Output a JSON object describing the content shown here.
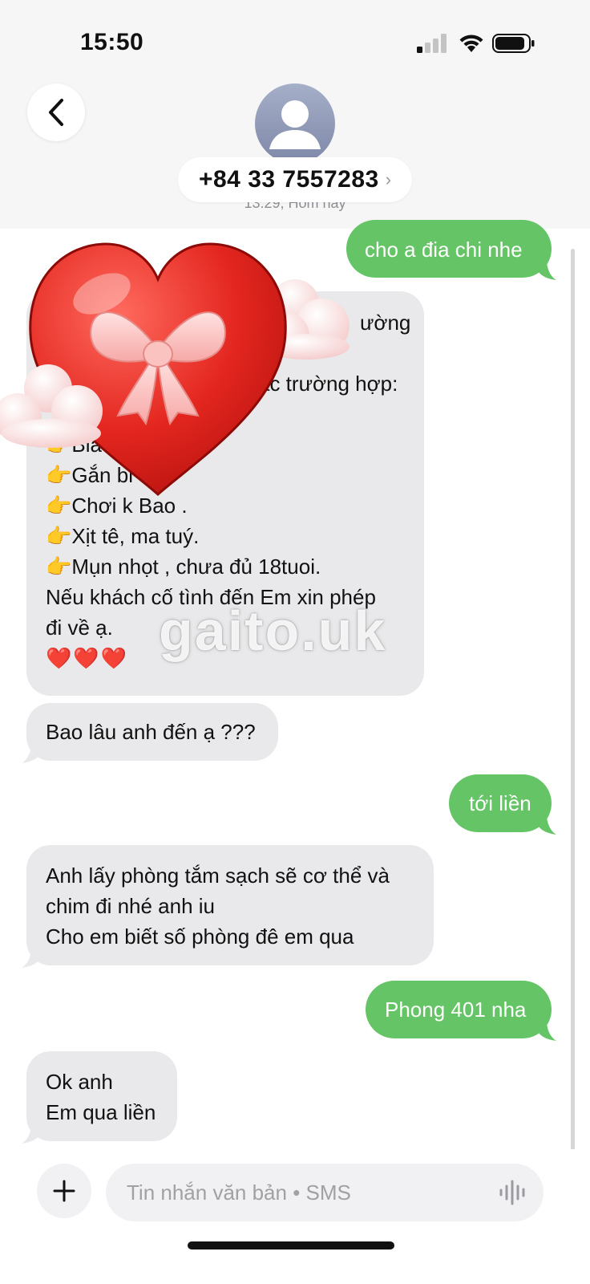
{
  "status_bar": {
    "time": "15:50"
  },
  "header": {
    "contact_number": "+84 33 7557283",
    "chevron": "›",
    "timestamp": "13:29, Hôm nay"
  },
  "messages": {
    "m1": {
      "direction": "outgoing",
      "lines": [
        "cho a đia chi nhe"
      ]
    },
    "m2": {
      "direction": "incoming",
      "lines": [
        "ường",
        "",
        "các trường hợp:",
        "",
        "👉Bia",
        "👉Gắn bi",
        "👉Chơi k Bao .",
        "👉Xịt tê, ma tuý.",
        "👉Mụn nhọt , chưa đủ 18tuoi.",
        "Nếu khách cố tình đến Em xin phép",
        "đi về ạ.",
        "❤️❤️❤️"
      ]
    },
    "m3": {
      "direction": "incoming",
      "lines": [
        "Bao lâu anh đến ạ ???"
      ]
    },
    "m4": {
      "direction": "outgoing",
      "lines": [
        "tới liền"
      ]
    },
    "m5": {
      "direction": "incoming",
      "lines": [
        "Anh lấy phòng tắm sạch sẽ cơ thể và",
        "chim đi nhé anh iu",
        "Cho em biết số phòng đê em qua"
      ]
    },
    "m6": {
      "direction": "outgoing",
      "lines": [
        "Phong 401 nha"
      ]
    },
    "m7": {
      "direction": "incoming",
      "lines": [
        "Ok anh",
        "Em qua liền"
      ]
    }
  },
  "watermark": "gaito.uk",
  "composer": {
    "placeholder": "Tin nhắn văn bản • SMS",
    "plus_icon": "plus-icon",
    "voice_icon": "waveform-icon"
  },
  "colors": {
    "outgoing_bubble": "#65c466",
    "incoming_bubble": "#e9e9eb",
    "header_bg": "#f6f6f7",
    "sticker_heart": "#e3261f"
  },
  "stickers": [
    "heart-with-bow-sticker",
    "cloud-sticker"
  ]
}
